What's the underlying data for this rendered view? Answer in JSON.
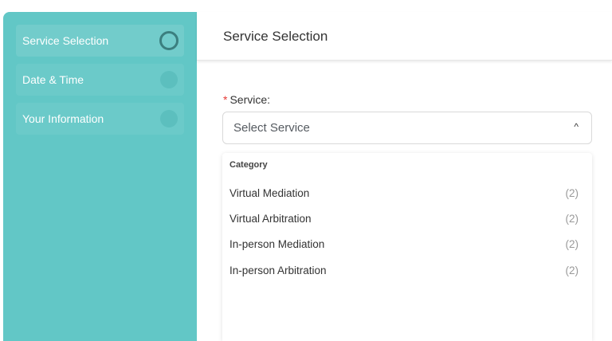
{
  "sidebar": {
    "steps": [
      {
        "label": "Service Selection"
      },
      {
        "label": "Date & Time"
      },
      {
        "label": "Your Information"
      }
    ]
  },
  "header": {
    "title": "Service Selection"
  },
  "form": {
    "required_mark": "*",
    "service_label": "Service:",
    "select_placeholder": "Select Service",
    "chevron": "^"
  },
  "dropdown": {
    "category_header": "Category",
    "options": [
      {
        "label": "Virtual Mediation",
        "count": "(2)"
      },
      {
        "label": "Virtual Arbitration",
        "count": "(2)"
      },
      {
        "label": "In-person Mediation",
        "count": "(2)"
      },
      {
        "label": "In-person Arbitration",
        "count": "(2)"
      }
    ]
  },
  "colors": {
    "sidebar": "#62c7c6",
    "active_step_ring": "#3b7f7f",
    "required": "#e53935"
  }
}
